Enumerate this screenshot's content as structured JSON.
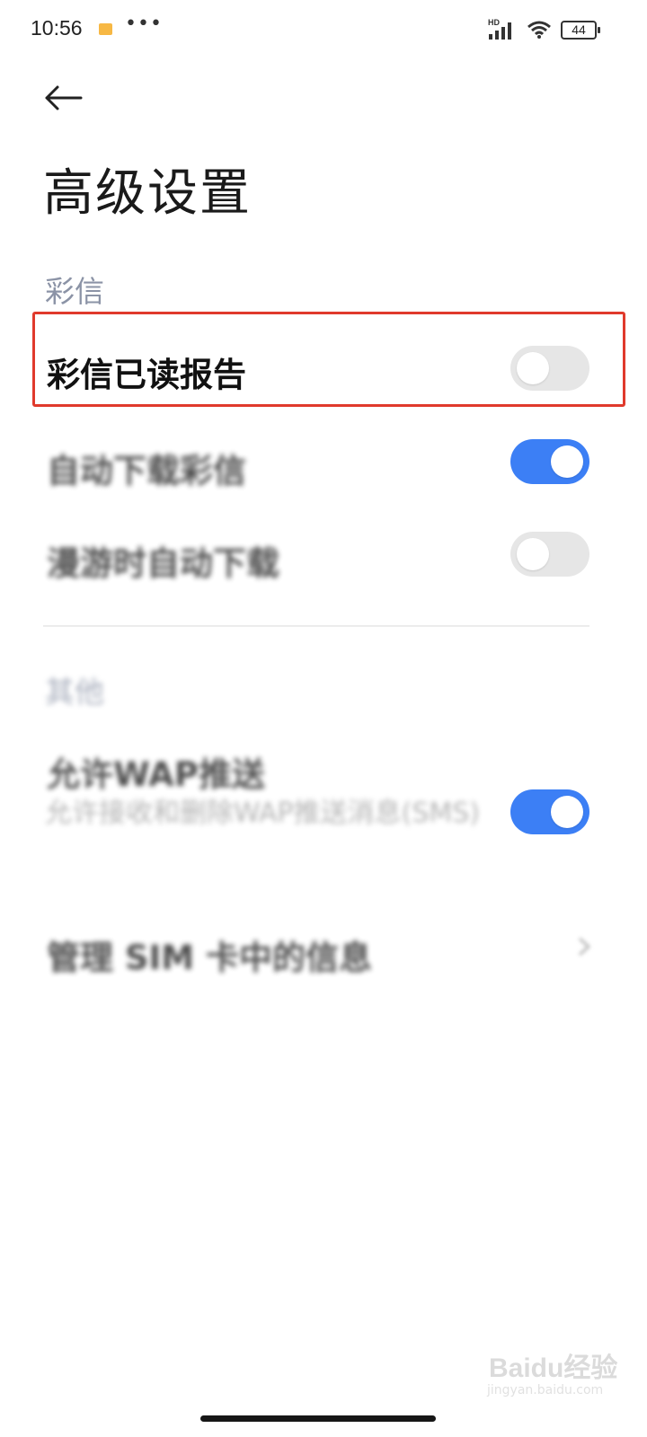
{
  "status_bar": {
    "time": "10:56",
    "dots": "•••",
    "hd_label": "HD",
    "battery": "44"
  },
  "page": {
    "title": "高级设置"
  },
  "sections": [
    {
      "header": "彩信",
      "items": [
        {
          "label": "彩信已读报告",
          "toggle_on": false,
          "highlighted": true
        },
        {
          "label": "自动下载彩信",
          "toggle_on": true
        },
        {
          "label": "漫游时自动下载",
          "toggle_on": false
        }
      ]
    },
    {
      "header": "其他",
      "items": [
        {
          "label": "允许WAP推送",
          "description": "允许接收和删除WAP推送消息(SMS)",
          "toggle_on": true
        },
        {
          "label": "管理 SIM 卡中的信息"
        }
      ]
    }
  ],
  "watermark": {
    "text": "Baidu经验",
    "sub": "jingyan.baidu.com"
  },
  "colors": {
    "accent": "#3c7ff5",
    "highlight": "#e03a2c",
    "section_header": "#8b93a6"
  },
  "icons": [
    "back-arrow-icon",
    "notification-icon",
    "signal-icon",
    "wifi-icon",
    "battery-icon",
    "chevron-right-icon"
  ]
}
